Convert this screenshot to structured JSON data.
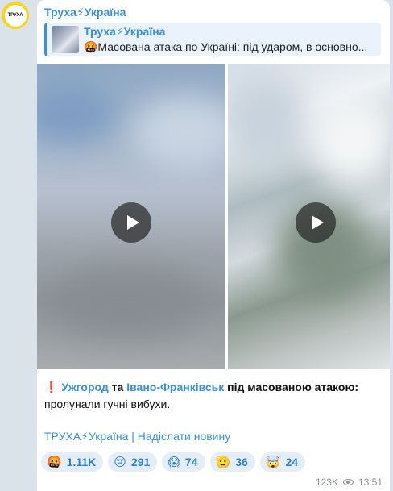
{
  "avatar": {
    "text": "ТРУХА"
  },
  "post": {
    "channel_name": "Труха⚡Україна",
    "reply": {
      "title": "Труха⚡Україна",
      "text": "🤬Масована атака по Україні: під ударом, в основно..."
    },
    "message": {
      "exclamation": "❗",
      "city1": "Ужгород",
      "connector": " та ",
      "city2": "Івано-Франківськ",
      "rest_line1": " під масованою атакою:",
      "line2": "пролунали гучні вибухи."
    },
    "footer": "ТРУХА⚡Україна | Надіслати новину",
    "reactions": [
      {
        "emoji": "🤬",
        "count": "1.11K"
      },
      {
        "emoji": "😢",
        "count": "291"
      },
      {
        "emoji": "😱",
        "count": "74"
      },
      {
        "emoji": "🫡",
        "count": "36"
      },
      {
        "emoji": "🤯",
        "count": "24"
      }
    ],
    "views": "123K",
    "time": "13:51"
  },
  "colors": {
    "link": "#3a8fd6",
    "background": "#dbe3ea",
    "reaction_bg": "#e4eef8",
    "avatar_ring": "#f7d51d"
  },
  "icons": {
    "play": "play-icon",
    "views": "eye-icon"
  }
}
